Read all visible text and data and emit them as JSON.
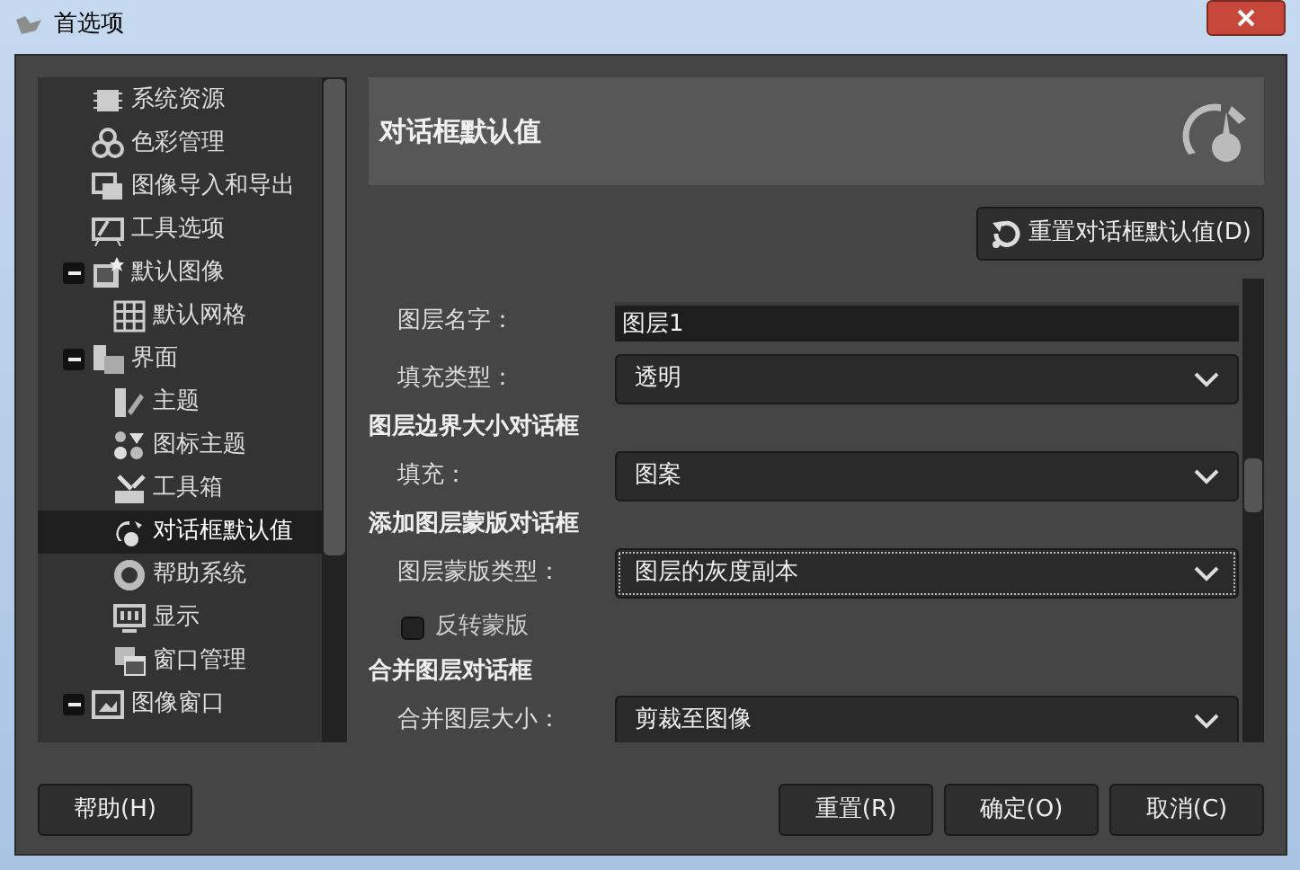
{
  "window": {
    "title": "首选项"
  },
  "tree": [
    {
      "label": "系统资源",
      "selected": false
    },
    {
      "label": "色彩管理",
      "selected": false
    },
    {
      "label": "图像导入和导出",
      "selected": false
    },
    {
      "label": "工具选项",
      "selected": false
    },
    {
      "label": "默认图像",
      "selected": false,
      "expanded": true,
      "children": [
        {
          "label": "默认网格",
          "selected": false
        }
      ]
    },
    {
      "label": "界面",
      "selected": false,
      "expanded": true,
      "children": [
        {
          "label": "主题",
          "selected": false
        },
        {
          "label": "图标主题",
          "selected": false
        },
        {
          "label": "工具箱",
          "selected": false
        },
        {
          "label": "对话框默认值",
          "selected": true
        },
        {
          "label": "帮助系统",
          "selected": false
        },
        {
          "label": "显示",
          "selected": false
        },
        {
          "label": "窗口管理",
          "selected": false
        }
      ]
    },
    {
      "label": "图像窗口",
      "selected": false,
      "expanded": true
    }
  ],
  "page": {
    "title": "对话框默认值",
    "reset_button": "重置对话框默认值(D)"
  },
  "sections": [
    {
      "rows": [
        {
          "kind": "input",
          "label": "图层名字：",
          "value": "图层1"
        },
        {
          "kind": "select",
          "label": "填充类型：",
          "value": "透明",
          "focused": false
        }
      ]
    },
    {
      "heading": "图层边界大小对话框",
      "rows": [
        {
          "kind": "select",
          "label": "填充：",
          "value": "图案",
          "focused": false
        }
      ]
    },
    {
      "heading": "添加图层蒙版对话框",
      "rows": [
        {
          "kind": "select",
          "label": "图层蒙版类型：",
          "value": "图层的灰度副本",
          "focused": true
        },
        {
          "kind": "checkbox",
          "label": "反转蒙版",
          "checked": false
        }
      ]
    },
    {
      "heading": "合并图层对话框",
      "rows": [
        {
          "kind": "select",
          "label": "合并图层大小：",
          "value": "剪裁至图像",
          "focused": false
        }
      ]
    }
  ],
  "buttons": [
    {
      "kind": "left",
      "label": "帮助(H)"
    },
    {
      "kind": "right",
      "label": "重置(R)"
    },
    {
      "kind": "right",
      "label": "确定(O)"
    },
    {
      "kind": "right",
      "label": "取消(C)"
    }
  ]
}
